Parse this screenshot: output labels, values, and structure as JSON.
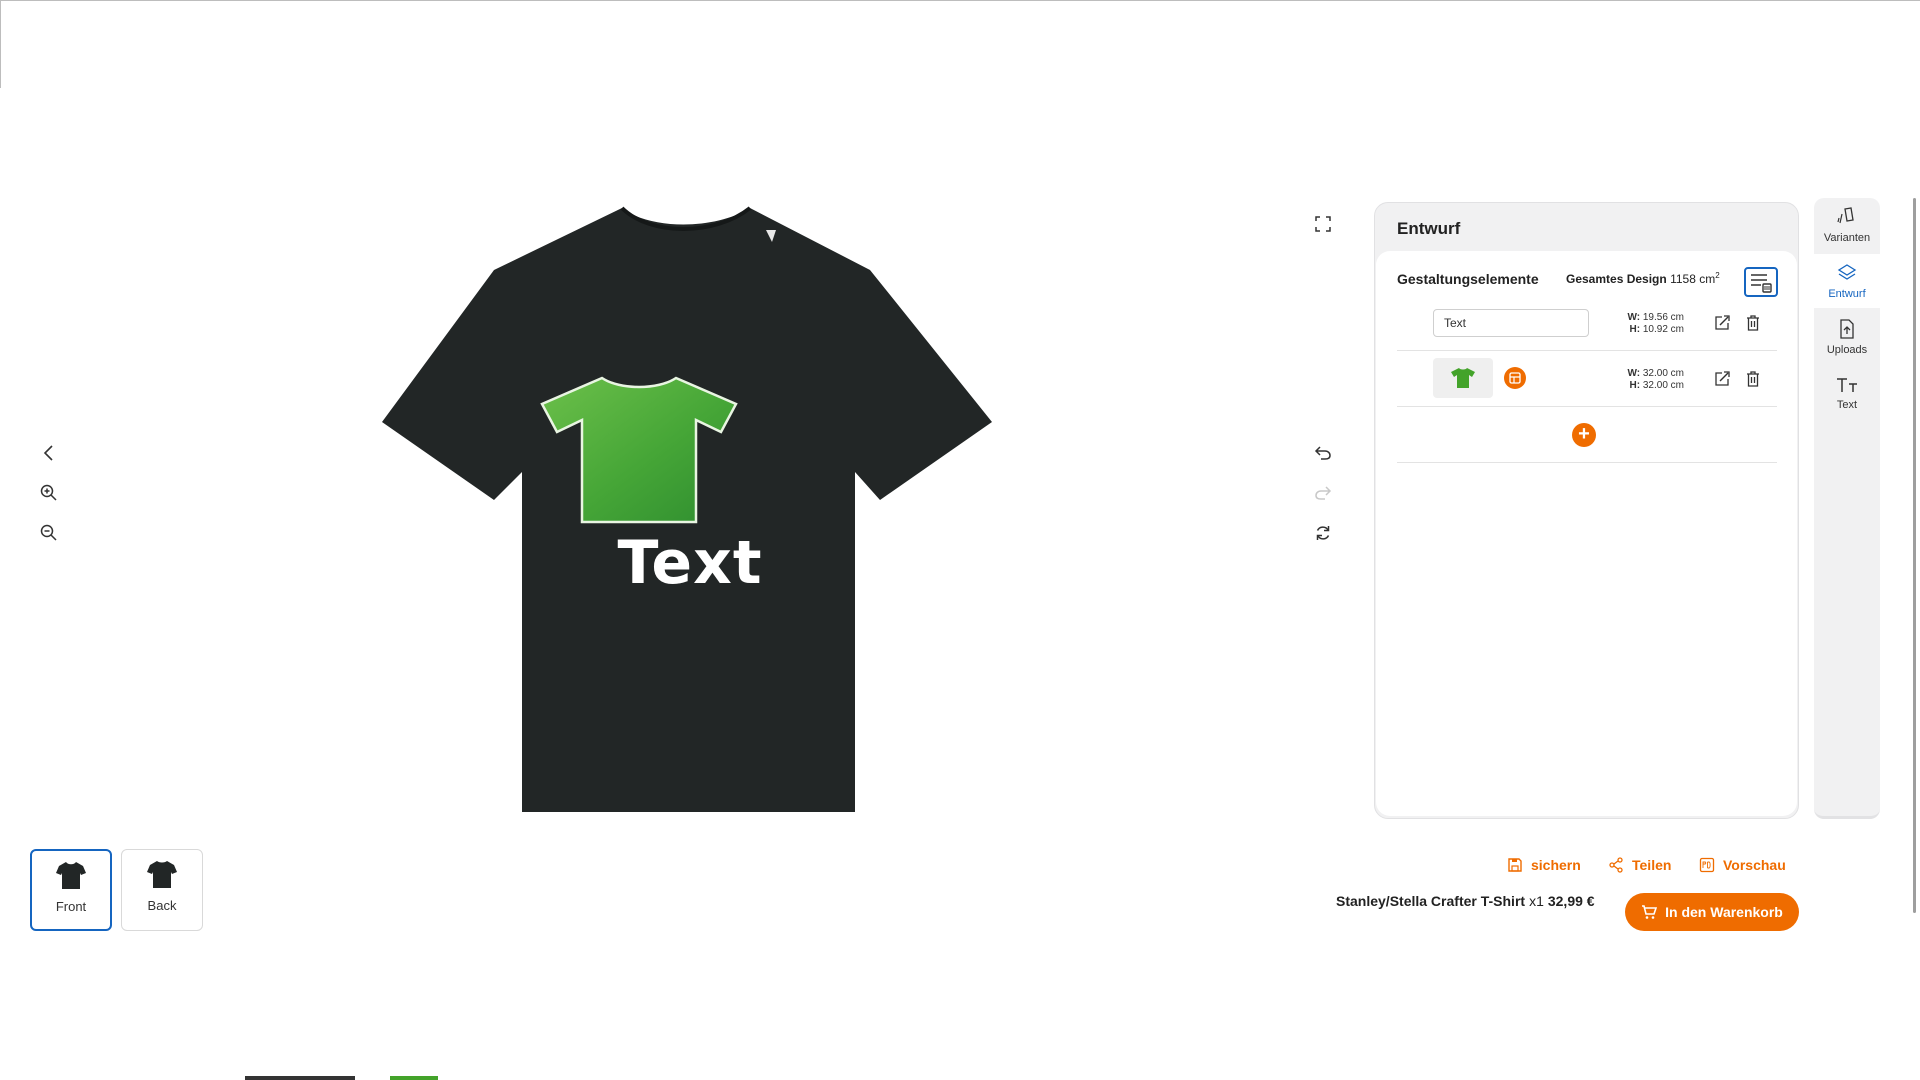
{
  "views": [
    {
      "label": "Front",
      "active": true
    },
    {
      "label": "Back",
      "active": false
    }
  ],
  "design": {
    "text_content": "Text"
  },
  "panel": {
    "title": "Entwurf",
    "elements_title": "Gestaltungselemente",
    "total_label": "Gesamtes Design",
    "total_value": "1158 cm",
    "total_sup": "2",
    "rows": [
      {
        "type": "text",
        "value": "Text",
        "w": "W:",
        "w_val": "19.56 cm",
        "h": "H:",
        "h_val": "10.92 cm"
      },
      {
        "type": "image",
        "w": "W:",
        "w_val": "32.00 cm",
        "h": "H:",
        "h_val": "32.00 cm"
      }
    ]
  },
  "sidebar": {
    "tabs": [
      {
        "label": "Varianten",
        "icon": "variants-icon"
      },
      {
        "label": "Entwurf",
        "icon": "layers-icon",
        "active": true
      },
      {
        "label": "Uploads",
        "icon": "upload-icon"
      },
      {
        "label": "Text",
        "icon": "text-icon"
      }
    ]
  },
  "actions": {
    "save": "sichern",
    "share": "Teilen",
    "preview": "Vorschau"
  },
  "product": {
    "name": "Stanley/Stella Crafter T-Shirt",
    "qty": "x1",
    "price": "32,99 €"
  },
  "cart_button": "In den Warenkorb",
  "colors": {
    "accent": "#ef6c00",
    "primary": "#1565c0",
    "shirt": "#222626",
    "design_green": "#43a32a"
  }
}
